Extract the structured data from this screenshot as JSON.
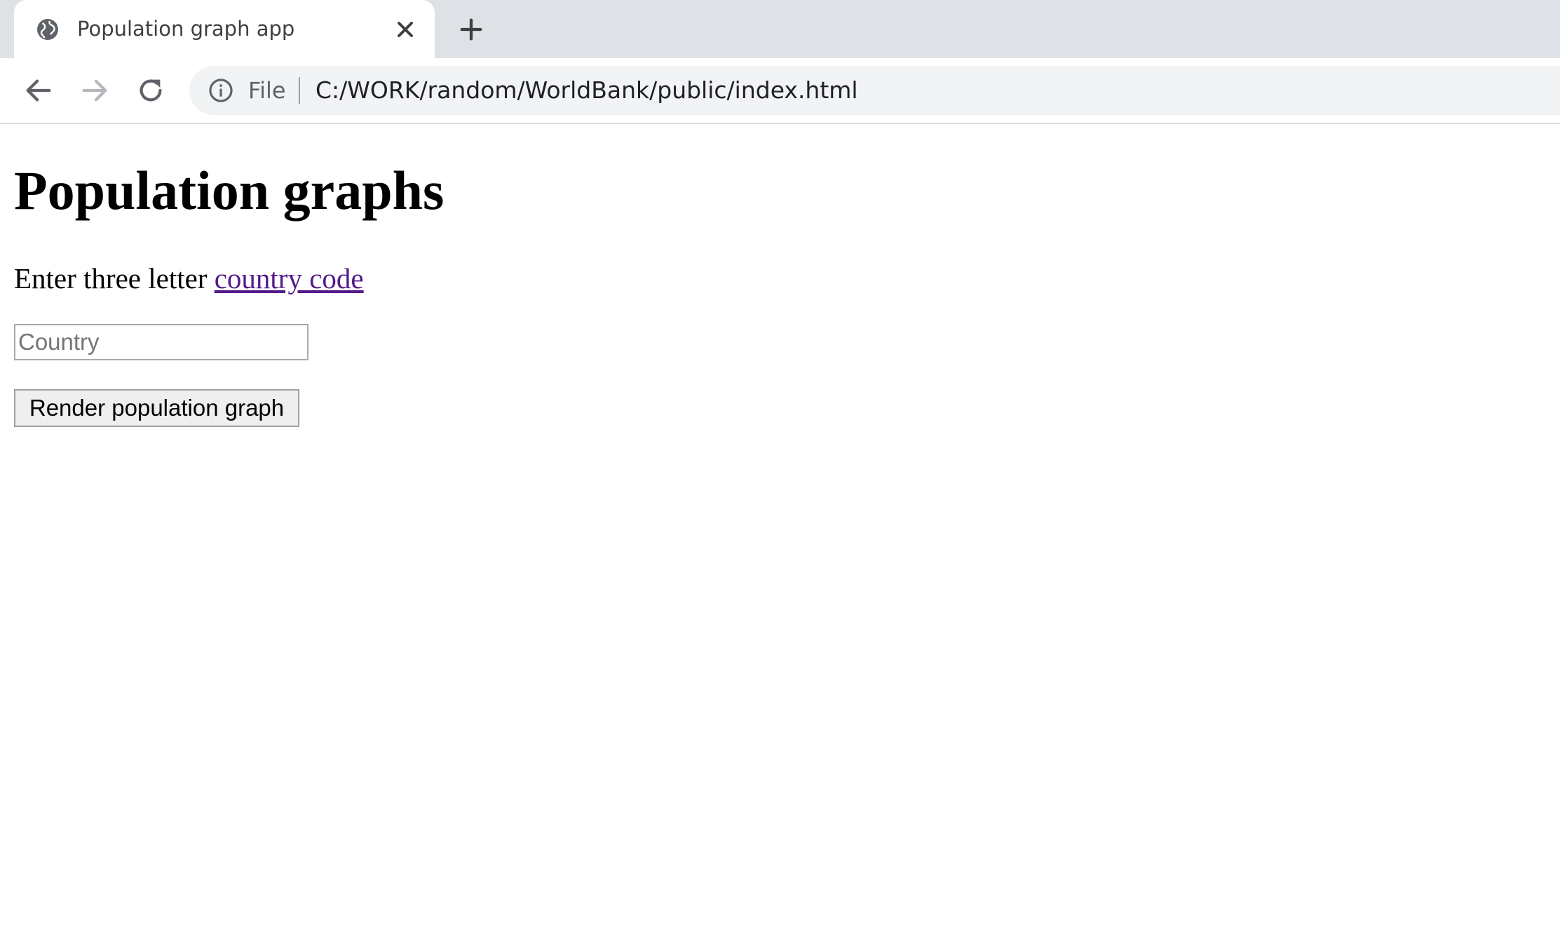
{
  "browser": {
    "tab": {
      "title": "Population graph app",
      "favicon": "globe-icon"
    },
    "new_tab_icon": "plus-icon",
    "toolbar": {
      "back_icon": "arrow-left-icon",
      "forward_icon": "arrow-right-icon",
      "reload_icon": "reload-icon",
      "info_icon": "info-icon",
      "scheme_label": "File",
      "url": "C:/WORK/random/WorldBank/public/index.html"
    }
  },
  "page": {
    "title": "Population graphs",
    "instructions_prefix": "Enter three letter ",
    "country_code_link": "country code",
    "country_input": {
      "placeholder": "Country",
      "value": ""
    },
    "render_button_label": "Render population graph"
  },
  "colors": {
    "tabstrip_bg": "#dee1e6",
    "omnibox_bg": "#f1f3f4",
    "visited_link": "#551a8b",
    "button_bg": "#efefef"
  }
}
